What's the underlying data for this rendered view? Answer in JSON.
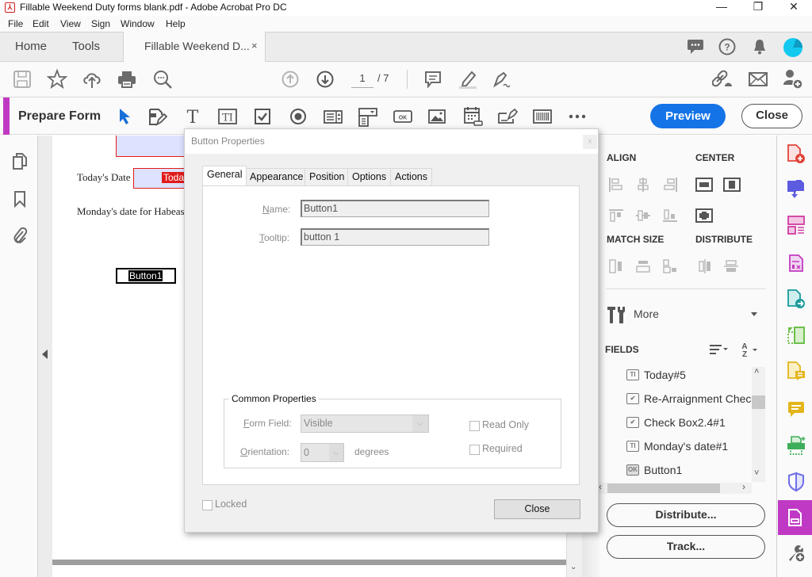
{
  "window": {
    "title": "Fillable Weekend Duty forms blank.pdf - Adobe Acrobat Pro DC",
    "minimize": "—",
    "restore": "❐",
    "close": "✕"
  },
  "menu": [
    "File",
    "Edit",
    "View",
    "Sign",
    "Window",
    "Help"
  ],
  "tabs": {
    "home": "Home",
    "tools": "Tools",
    "document": "Fillable Weekend D...",
    "document_close": "×"
  },
  "top_icons": [
    "chat-icon",
    "help-icon",
    "bell-icon",
    "account-avatar"
  ],
  "toolbar": {
    "page_current": "1",
    "page_total": "/ 7",
    "left_icons": [
      "save-icon",
      "bookmark-star-icon",
      "upload-cloud-icon",
      "print-icon",
      "search-zoom-icon"
    ],
    "nav_icons": [
      "page-up-icon",
      "page-down-icon"
    ],
    "annot_icons": [
      "comment-icon",
      "highlight-pen-icon",
      "sign-pen-icon"
    ],
    "right_icons": [
      "share-link-icon",
      "email-icon",
      "add-user-icon"
    ]
  },
  "prepare_form": {
    "title": "Prepare Form",
    "tools": [
      "select-arrow-icon",
      "edit-form-icon",
      "text-tool-icon",
      "text-field-icon",
      "checkbox-tool-icon",
      "radio-tool-icon",
      "list-box-icon",
      "dropdown-tool-icon",
      "button-tool-icon",
      "image-tool-icon",
      "date-tool-icon",
      "signature-tool-icon",
      "barcode-tool-icon",
      "more-icon"
    ],
    "preview": "Preview",
    "close": "Close"
  },
  "left_rail": [
    "pages-icon",
    "bookmarks-icon",
    "attachments-icon"
  ],
  "document": {
    "todays_date_label": "Today's Date",
    "todays_date_field": "Today",
    "mondays_label": "Monday's date for Habeas",
    "button_field": "Button1"
  },
  "dialog": {
    "title": "Button Properties",
    "close_x": "x",
    "tabs": [
      "General",
      "Appearance",
      "Position",
      "Options",
      "Actions"
    ],
    "active_tab": "General",
    "name_label": "Name:",
    "name_value": "Button1",
    "tooltip_label": "Tooltip:",
    "tooltip_value": "button 1",
    "common_properties": "Common Properties",
    "form_field_label": "Form Field:",
    "form_field_value": "Visible",
    "orientation_label": "Orientation:",
    "orientation_value": "0",
    "degrees": "degrees",
    "read_only": "Read Only",
    "required": "Required",
    "locked": "Locked",
    "close_button": "Close"
  },
  "right_panel": {
    "align": "ALIGN",
    "center": "CENTER",
    "match_size": "MATCH SIZE",
    "distribute": "DISTRIBUTE",
    "more": "More",
    "fields_header": "FIELDS",
    "fields": [
      {
        "type": "text",
        "icon": "TI",
        "name": "Today#5"
      },
      {
        "type": "checkbox",
        "icon": "✔",
        "name": "Re-Arraignment Check"
      },
      {
        "type": "checkbox",
        "icon": "✔",
        "name": "Check Box2.4#1"
      },
      {
        "type": "text",
        "icon": "TI",
        "name": "Monday's date#1"
      },
      {
        "type": "button",
        "icon": "OK",
        "name": "Button1"
      }
    ],
    "distribute_button": "Distribute...",
    "track_button": "Track..."
  },
  "icon_rail": [
    {
      "name": "create-pdf-icon",
      "color": "#e0453b"
    },
    {
      "name": "combine-files-icon",
      "color": "#5c5ce0"
    },
    {
      "name": "organize-pages-icon",
      "color": "#d03ca0"
    },
    {
      "name": "edit-pdf-icon",
      "color": "#c23ac2"
    },
    {
      "name": "export-pdf-icon",
      "color": "#199a9a"
    },
    {
      "name": "scan-ocr-icon",
      "color": "#6cc04a"
    },
    {
      "name": "comment-tool-icon",
      "color": "#e2b51a"
    },
    {
      "name": "comment-bubble-icon",
      "color": "#e2b51a"
    },
    {
      "name": "print-production-icon",
      "color": "#3fae5a"
    },
    {
      "name": "protect-icon",
      "color": "#6f6fe8"
    },
    {
      "name": "prepare-form-icon",
      "color": "#c039c4"
    },
    {
      "name": "more-tools-icon",
      "color": "#666666"
    }
  ],
  "colors": {
    "accent": "#c039c4",
    "preview_blue": "#1473e6",
    "field_highlight": "#dde3ff",
    "field_border_red": "#e21b1b"
  }
}
